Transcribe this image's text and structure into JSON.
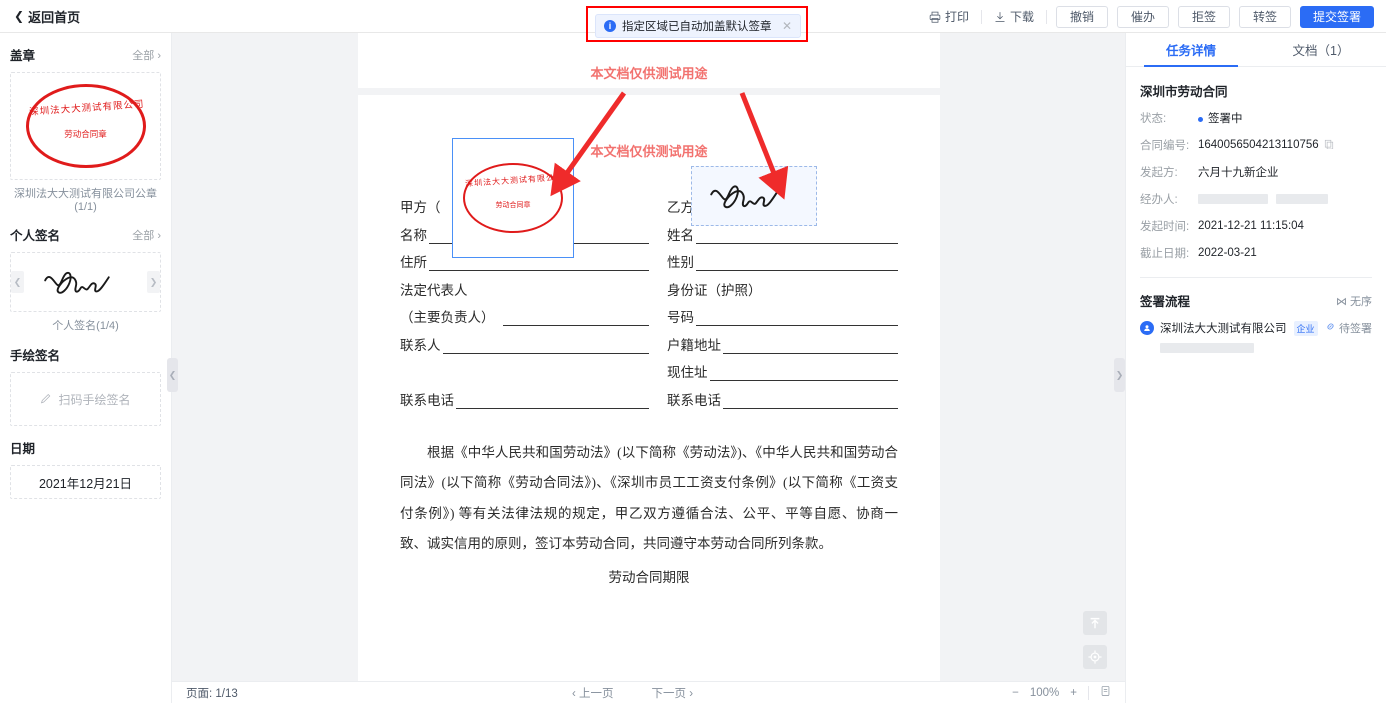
{
  "topbar": {
    "back_label": "返回首页",
    "print_label": "打印",
    "download_label": "下载",
    "buttons": [
      {
        "label": "撤销"
      },
      {
        "label": "催办"
      },
      {
        "label": "拒签"
      },
      {
        "label": "转签"
      }
    ],
    "primary_label": "提交签署",
    "primary_color": "#2b6cf5"
  },
  "toast": {
    "message": "指定区域已自动加盖默认签章",
    "close": "✕",
    "highlight_color": "#ff0000"
  },
  "sidebar": {
    "seal": {
      "title": "盖章",
      "all_label": "全部",
      "seal_ring_text": "深圳法大大测试有限公司",
      "seal_center_text": "劳动合同章",
      "caption": "深圳法大大测试有限公司公章(1/1)"
    },
    "personal_signature": {
      "title": "个人签名",
      "all_label": "全部",
      "caption": "个人签名(1/4)"
    },
    "hand_signature": {
      "title": "手绘签名",
      "action_label": "扫码手绘签名"
    },
    "date": {
      "title": "日期",
      "value": "2021年12月21日"
    }
  },
  "document": {
    "watermark_1": "本文档仅供测试用途",
    "watermark_2": "本文档仅供测试用途",
    "party_a": {
      "heading": "甲方（",
      "fields": [
        {
          "label": "名称",
          "line": true
        },
        {
          "label": "住所",
          "line": true
        },
        {
          "label": "法定代表人",
          "line": false
        },
        {
          "label": "（主要负责人）",
          "line": true
        },
        {
          "label": "联系人",
          "line": true
        },
        {
          "label": "",
          "line": false
        },
        {
          "label": "联系电话",
          "line": true
        }
      ]
    },
    "party_b": {
      "heading": "乙方(员工)",
      "fields": [
        {
          "label": "姓名",
          "line": true
        },
        {
          "label": "性别",
          "line": true
        },
        {
          "label": "身份证（护照）",
          "line": false
        },
        {
          "label": "号码",
          "line": true
        },
        {
          "label": "户籍地址",
          "line": true
        },
        {
          "label": "现住址",
          "line": true
        },
        {
          "label": "联系电话",
          "line": true
        }
      ]
    },
    "paragraph": "根据《中华人民共和国劳动法》(以下简称《劳动法》)、《中华人民共和国劳动合同法》(以下简称《劳动合同法》)、《深圳市员工工资支付条例》(以下简称《工资支付条例》) 等有关法律法规的规定，甲乙双方遵循合法、公平、平等自愿、协商一致、诚实信用的原则，签订本劳动合同，共同遵守本劳动合同所列条款。",
    "next_section": "劳动合同期限"
  },
  "bottombar": {
    "page_label": "页面:",
    "page_value": "1/13",
    "prev_label": "上一页",
    "next_label": "下一页",
    "zoom_out": "−",
    "zoom_value": "100%",
    "zoom_in": "+"
  },
  "rightpanel": {
    "tabs": [
      {
        "label": "任务详情",
        "active": true
      },
      {
        "label": "文档（1）",
        "active": false
      }
    ],
    "title": "深圳市劳动合同",
    "details": [
      {
        "key": "状态:",
        "value": "签署中",
        "type": "status"
      },
      {
        "key": "合同编号:",
        "value": "1640056504213110756",
        "type": "copy"
      },
      {
        "key": "发起方:",
        "value": "六月十九新企业",
        "type": "text"
      },
      {
        "key": "经办人:",
        "value": "",
        "type": "masked"
      },
      {
        "key": "发起时间:",
        "value": "2021-12-21 11:15:04",
        "type": "text"
      },
      {
        "key": "截止日期:",
        "value": "2022-03-21",
        "type": "text"
      }
    ],
    "flow": {
      "title": "签署流程",
      "unordered_label": "无序",
      "participants": [
        {
          "name": "深圳法大大测试有限公司",
          "tag": "企业",
          "status": "待签署"
        }
      ]
    }
  }
}
